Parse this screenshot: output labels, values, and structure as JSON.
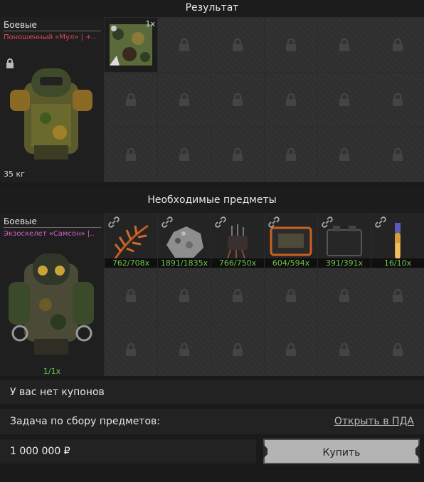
{
  "result": {
    "title": "Результат",
    "category": "Боевые",
    "item_name": "Поношенный «Мул» | +..",
    "weight": "35 кг",
    "slot_badge": "1x"
  },
  "required": {
    "title": "Необходимые предметы",
    "category": "Боевые",
    "item_name": "Экзоскелет «Самсон» |..",
    "count": "1/1x",
    "items": [
      {
        "qty": "762/708x",
        "icon": "fern-leaf-icon"
      },
      {
        "qty": "1891/1835x",
        "icon": "ore-chunk-icon"
      },
      {
        "qty": "766/750x",
        "icon": "wire-device-icon"
      },
      {
        "qty": "604/594x",
        "icon": "pda-device-icon"
      },
      {
        "qty": "391/391x",
        "icon": "battery-block-icon"
      },
      {
        "qty": "16/10x",
        "icon": "vial-icon"
      }
    ]
  },
  "coupons": {
    "text": "У вас нет купонов"
  },
  "task": {
    "label": "Задача по сбору предметов:",
    "link": "Открыть в ПДА"
  },
  "purchase": {
    "price": "1 000 000 ₽",
    "buy_label": "Купить"
  },
  "colors": {
    "green": "#6fc24a",
    "red": "#e0465e",
    "pink": "#d85fc4"
  }
}
